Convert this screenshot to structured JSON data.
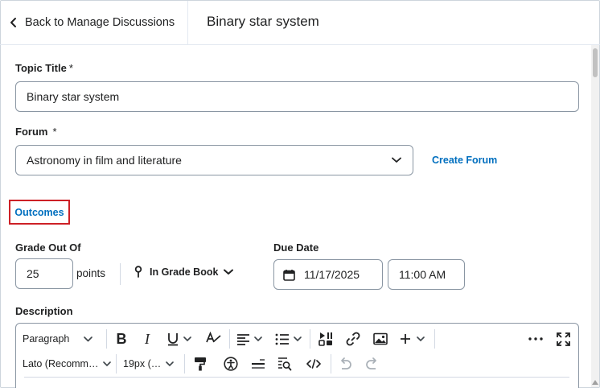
{
  "header": {
    "back_label": "Back to Manage Discussions",
    "title": "Binary star system"
  },
  "topic": {
    "label": "Topic Title",
    "required_mark": "*",
    "value": "Binary star system"
  },
  "forum": {
    "label": "Forum",
    "required_mark": "*",
    "selected": "Astronomy in film and literature",
    "create_link": "Create Forum"
  },
  "outcomes": {
    "label": "Outcomes"
  },
  "grade": {
    "label": "Grade Out Of",
    "value": "25",
    "unit": "points",
    "gradebook_label": "In Grade Book"
  },
  "due": {
    "label": "Due Date",
    "date": "11/17/2025",
    "time": "11:00 AM"
  },
  "description": {
    "label": "Description",
    "toolbar": {
      "paragraph": "Paragraph",
      "font": "Lato (Recomm…",
      "size": "19px (…"
    }
  },
  "colors": {
    "link": "#006fbf",
    "highlight_border": "#cd2026",
    "input_border": "#8a96a3"
  },
  "icons": [
    "chevron-left-icon",
    "chevron-down-icon",
    "map-pin-icon",
    "calendar-icon",
    "bold-icon",
    "italic-icon",
    "underline-icon",
    "strikethrough-icon",
    "align-icon",
    "list-icon",
    "insert-media-icon",
    "link-icon",
    "image-icon",
    "plus-icon",
    "more-icon",
    "fullscreen-icon",
    "format-painter-icon",
    "accessibility-icon",
    "line-icon",
    "find-replace-icon",
    "code-icon",
    "undo-icon",
    "redo-icon"
  ]
}
